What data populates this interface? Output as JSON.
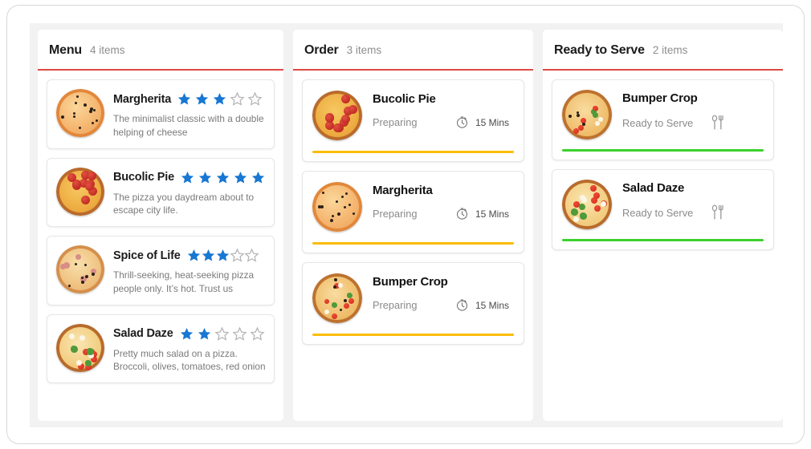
{
  "columns": [
    {
      "id": "menu",
      "title": "Menu",
      "count_label": "4 items",
      "accent": "#dd4b44",
      "items": [
        {
          "name": "Margherita",
          "description": "The minimalist classic with a double helping of cheese",
          "rating": 3,
          "max_rating": 5,
          "image": "margherita-pizza"
        },
        {
          "name": "Bucolic Pie",
          "description": "The pizza you daydream about to escape city life.",
          "rating": 5,
          "max_rating": 5,
          "image": "pepperoni-pizza"
        },
        {
          "name": "Spice of Life",
          "description": "Thrill-seeking, heat-seeking pizza people only. It’s hot. Trust us",
          "rating": 3,
          "max_rating": 5,
          "image": "spicy-pizza"
        },
        {
          "name": "Salad Daze",
          "description": "Pretty much salad on a pizza. Broccoli, olives, tomatoes, red onion",
          "rating": 2,
          "max_rating": 5,
          "image": "salad-pizza"
        }
      ]
    },
    {
      "id": "order",
      "title": "Order",
      "count_label": "3 items",
      "accent": "#dd4b44",
      "items": [
        {
          "name": "Bucolic Pie",
          "status": "Preparing",
          "time": "15 Mins",
          "icon": "timer-icon",
          "progress_color": "#fbbc04",
          "image": "pepperoni-pizza"
        },
        {
          "name": "Margherita",
          "status": "Preparing",
          "time": "15 Mins",
          "icon": "timer-icon",
          "progress_color": "#fbbc04",
          "image": "margherita-pizza"
        },
        {
          "name": "Bumper Crop",
          "status": "Preparing",
          "time": "15 Mins",
          "icon": "timer-icon",
          "progress_color": "#fbbc04",
          "image": "bumper-crop-pizza"
        }
      ]
    },
    {
      "id": "ready",
      "title": "Ready to Serve",
      "count_label": "2 items",
      "accent": "#dd4b44",
      "items": [
        {
          "name": "Bumper Crop",
          "status": "Ready to Serve",
          "icon": "cutlery-icon",
          "progress_color": "#3ad12c",
          "image": "bumper-crop-pizza"
        },
        {
          "name": "Salad Daze",
          "status": "Ready to Serve",
          "icon": "cutlery-icon",
          "progress_color": "#3ad12c",
          "image": "salad-pizza"
        }
      ]
    }
  ],
  "theme": {
    "star_filled": "#1877d2",
    "star_empty": "#b5b5b5",
    "divider": "#dd4b44",
    "board_bg": "#f2f2f2",
    "card_bg": "#ffffff"
  }
}
